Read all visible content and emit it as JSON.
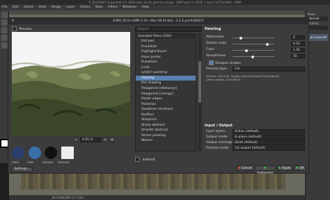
{
  "gimp": {
    "title": "*[_8131084] (imported)-1.0 (RGB color 16-bit gamma integer, GIMP built-in sRGB, 1 layer) 5472x3648 – GIMP",
    "menu": [
      "File",
      "Edit",
      "Select",
      "View",
      "Image",
      "Layer",
      "Colors",
      "Tools",
      "Filters",
      "Windows",
      "Help"
    ],
    "status": "_8131084.NEF (1.7 GB)",
    "dock": {
      "mode_label": "Mode",
      "mode_value": "Normal",
      "opacity_label": "Opacity",
      "layer_label": "_8131084.NEF"
    }
  },
  "gmic": {
    "title": "G'MIC-Qt for GIMP 2.10 - Mac OS 64 bits - 2.2.3_pre#180427",
    "preview_label": "Preview",
    "zoom_value": "6.65 %",
    "logo_labels": [
      "GREYC",
      "CNRS",
      "UNICAEN",
      "ENSICAEN"
    ],
    "settings_label": "Settings...",
    "search_placeholder": "Search",
    "filter_list_header": "Available filters (526)",
    "filters": [
      "Felt pen",
      "Fractalize",
      "Highlight bloom",
      "Hope poster",
      "Kuwahara",
      "Linify",
      "Lylejk's painting",
      "Painting",
      "Pen drawing",
      "Polygonize [delaunay]",
      "Polygonize [energy]",
      "Poster edges",
      "Posterize",
      "Quadtree variations",
      "Rodilius",
      "Shapeism",
      "Sharp abstract",
      "Smooth abstract",
      "Vector painting",
      "Warhol"
    ],
    "selected_filter": "Painting",
    "internet_label": "Internet",
    "params": {
      "title": "Painting",
      "abstraction": {
        "label": "Abstraction",
        "value": "2"
      },
      "details_scale": {
        "label": "Details scale",
        "value": "4.01"
      },
      "color": {
        "label": "Color",
        "value": "1.50"
      },
      "smoothness": {
        "label": "Smoothness",
        "value": "50"
      },
      "sharpen_shades_label": "Sharpen shades",
      "preview_type": {
        "label": "Preview type",
        "value": "Full"
      },
      "credits": [
        "Authors: Lyle Kroll, Angelo Lama and David Tschumperlé.",
        "Latest update: 2015/08/05."
      ]
    },
    "io": {
      "title": "Input / Output",
      "input_layers": {
        "label": "Input layers",
        "value": "Active (default)"
      },
      "output_mode": {
        "label": "Output mode",
        "value": "In place (default)"
      },
      "output_messages": {
        "label": "Output messages",
        "value": "Quiet (default)"
      },
      "preview_mode": {
        "label": "Preview mode",
        "value": "1st output (default)"
      }
    },
    "buttons": {
      "cancel": "Cancel",
      "fullscreen": "Fullscreen",
      "apply": "Apply",
      "ok": "OK"
    }
  }
}
